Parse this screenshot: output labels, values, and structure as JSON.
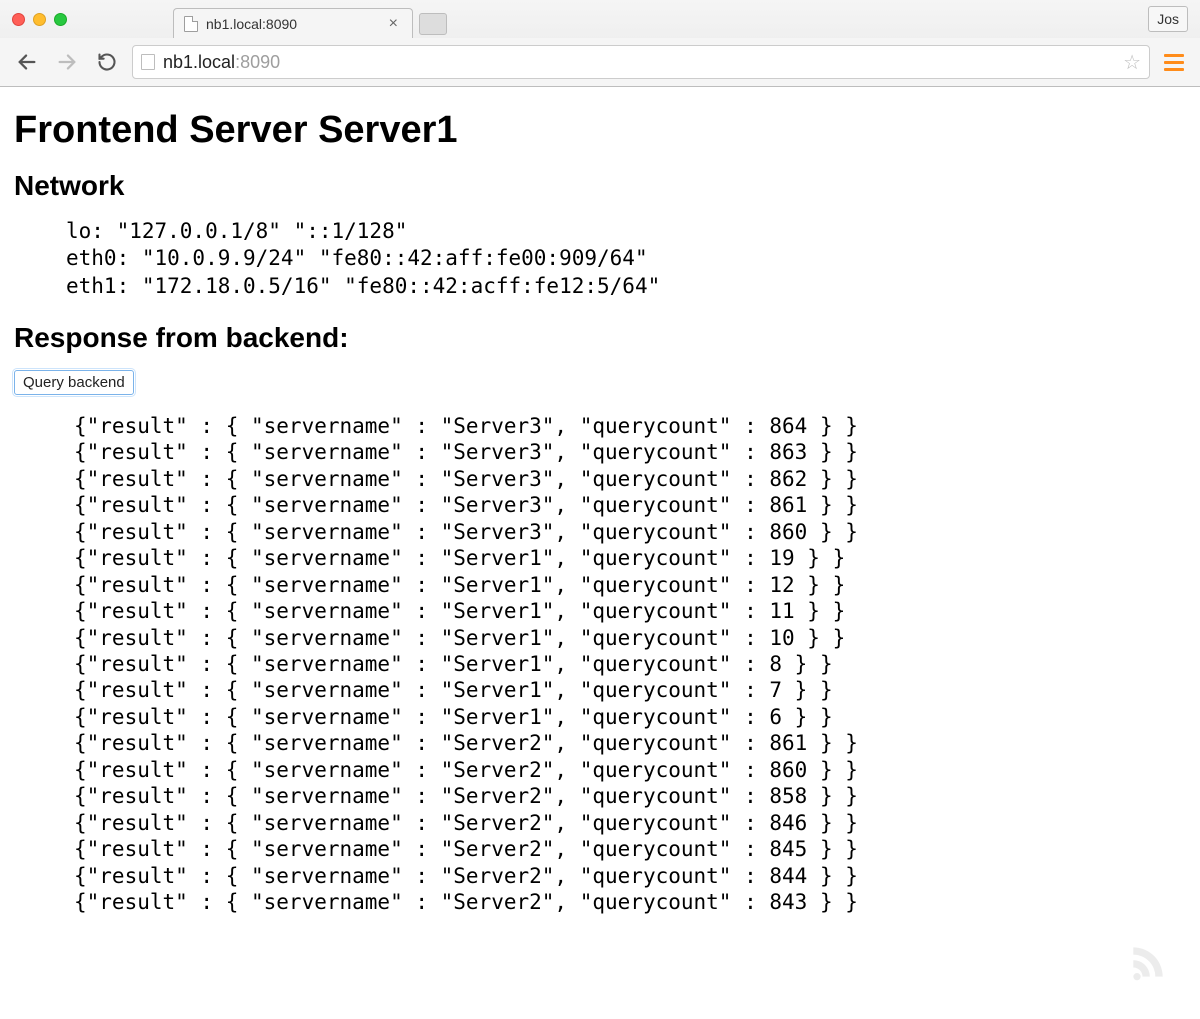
{
  "browser": {
    "tab_title": "nb1.local:8090",
    "profile": "Jos",
    "url_host": "nb1.local",
    "url_port": ":8090"
  },
  "page": {
    "title": "Frontend Server Server1",
    "network_heading": "Network",
    "network_lines": [
      "lo: \"127.0.0.1/8\" \"::1/128\"",
      "eth0: \"10.0.9.9/24\" \"fe80::42:aff:fe00:909/64\"",
      "eth1: \"172.18.0.5/16\" \"fe80::42:acff:fe12:5/64\""
    ],
    "response_heading": "Response from backend:",
    "query_button": "Query backend",
    "results": [
      {
        "servername": "Server3",
        "querycount": 864
      },
      {
        "servername": "Server3",
        "querycount": 863
      },
      {
        "servername": "Server3",
        "querycount": 862
      },
      {
        "servername": "Server3",
        "querycount": 861
      },
      {
        "servername": "Server3",
        "querycount": 860
      },
      {
        "servername": "Server1",
        "querycount": 19
      },
      {
        "servername": "Server1",
        "querycount": 12
      },
      {
        "servername": "Server1",
        "querycount": 11
      },
      {
        "servername": "Server1",
        "querycount": 10
      },
      {
        "servername": "Server1",
        "querycount": 8
      },
      {
        "servername": "Server1",
        "querycount": 7
      },
      {
        "servername": "Server1",
        "querycount": 6
      },
      {
        "servername": "Server2",
        "querycount": 861
      },
      {
        "servername": "Server2",
        "querycount": 860
      },
      {
        "servername": "Server2",
        "querycount": 858
      },
      {
        "servername": "Server2",
        "querycount": 846
      },
      {
        "servername": "Server2",
        "querycount": 845
      },
      {
        "servername": "Server2",
        "querycount": 844
      },
      {
        "servername": "Server2",
        "querycount": 843
      }
    ]
  }
}
